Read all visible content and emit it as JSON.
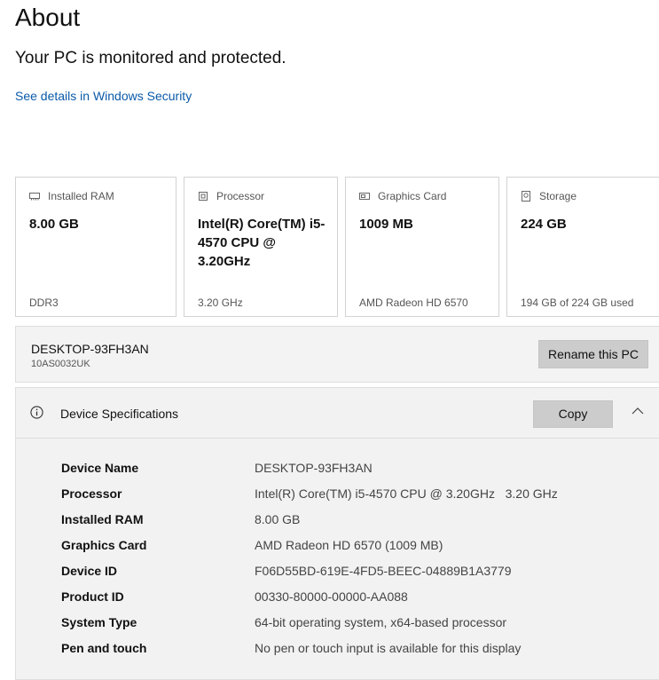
{
  "page": {
    "title": "About",
    "protection_status": "Your PC is monitored and protected.",
    "security_link": "See details in Windows Security"
  },
  "cards": [
    {
      "icon": "ram-icon",
      "label": "Installed RAM",
      "value": "8.00 GB",
      "footer": "DDR3"
    },
    {
      "icon": "processor-icon",
      "label": "Processor",
      "value": "Intel(R) Core(TM) i5-4570 CPU @ 3.20GHz",
      "footer": "3.20 GHz"
    },
    {
      "icon": "graphics-card-icon",
      "label": "Graphics Card",
      "value": "1009 MB",
      "footer": "AMD Radeon HD 6570"
    },
    {
      "icon": "storage-icon",
      "label": "Storage",
      "value": "224 GB",
      "footer": "194 GB of 224 GB used"
    }
  ],
  "pc": {
    "name": "DESKTOP-93FH3AN",
    "model": "10AS0032UK",
    "rename_label": "Rename this PC"
  },
  "specs": {
    "title": "Device Specifications",
    "copy_label": "Copy",
    "rows": [
      {
        "key": "Device Name",
        "value": "DESKTOP-93FH3AN"
      },
      {
        "key": "Processor",
        "value": "Intel(R) Core(TM) i5-4570 CPU @ 3.20GHz   3.20 GHz"
      },
      {
        "key": "Installed RAM",
        "value": "8.00 GB"
      },
      {
        "key": "Graphics Card",
        "value": "AMD Radeon HD 6570 (1009 MB)"
      },
      {
        "key": "Device ID",
        "value": "F06D55BD-619E-4FD5-BEEC-04889B1A3779"
      },
      {
        "key": "Product ID",
        "value": "00330-80000-00000-AA088"
      },
      {
        "key": "System Type",
        "value": "64-bit operating system, x64-based processor"
      },
      {
        "key": "Pen and touch",
        "value": "No pen or touch input is available for this display"
      }
    ]
  },
  "colors": {
    "link": "#0a5aa8",
    "button_bg": "#cccccc",
    "panel_bg": "#f2f2f2"
  }
}
